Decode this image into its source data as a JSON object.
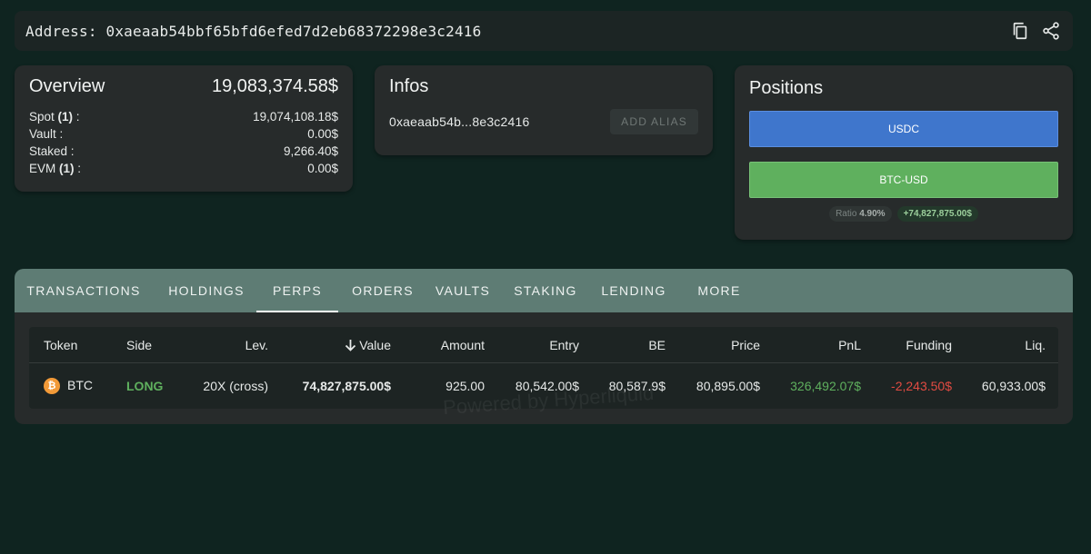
{
  "address_bar": {
    "label": "Address: 0xaeaab54bbf65bfd6efed7d2eb68372298e3c2416",
    "copy_icon": "copy-icon",
    "share_icon": "share-icon"
  },
  "overview": {
    "title": "Overview",
    "total": "19,083,374.58$",
    "rows": [
      {
        "label": "Spot",
        "count": "(1)",
        "suffix": " :",
        "value": "19,074,108.18$"
      },
      {
        "label": "Vault :",
        "count": "",
        "suffix": "",
        "value": "0.00$"
      },
      {
        "label": "Staked :",
        "count": "",
        "suffix": "",
        "value": "9,266.40$"
      },
      {
        "label": "EVM",
        "count": "(1)",
        "suffix": " :",
        "value": "0.00$"
      }
    ]
  },
  "infos": {
    "title": "Infos",
    "short_address": "0xaeaab54b...8e3c2416",
    "add_alias_label": "ADD ALIAS"
  },
  "positions": {
    "title": "Positions",
    "usdc_label": "USDC",
    "btc_label": "BTC-USD",
    "ratio_label": "Ratio",
    "ratio_value": "4.90%",
    "pnl_chip": "+74,827,875.00$",
    "colors": {
      "usdc": "#3f76cc",
      "btc": "#5fb05e"
    }
  },
  "tabs": [
    {
      "label": "TRANSACTIONS"
    },
    {
      "label": "HOLDINGS"
    },
    {
      "label": "PERPS",
      "active": true
    },
    {
      "label": "ORDERS"
    },
    {
      "label": "VAULTS"
    },
    {
      "label": "STAKING"
    },
    {
      "label": "LENDING"
    },
    {
      "label": "MORE"
    }
  ],
  "table": {
    "headers": {
      "token": "Token",
      "side": "Side",
      "lev": "Lev.",
      "value": "Value",
      "amount": "Amount",
      "entry": "Entry",
      "be": "BE",
      "price": "Price",
      "pnl": "PnL",
      "funding": "Funding",
      "liq": "Liq."
    },
    "rows": [
      {
        "token": "BTC",
        "token_icon": "bitcoin-icon",
        "side": "LONG",
        "lev": "20X (cross)",
        "value": "74,827,875.00$",
        "amount": "925.00",
        "entry": "80,542.00$",
        "be": "80,587.9$",
        "price": "80,895.00$",
        "pnl": "326,492.07$",
        "funding": "-2,243.50$",
        "liq": "60,933.00$"
      }
    ],
    "watermark": "Powered by Hyperliquid"
  }
}
